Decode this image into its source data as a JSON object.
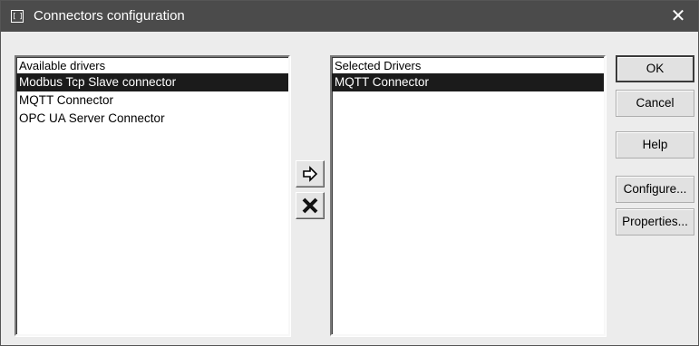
{
  "window": {
    "title": "Connectors configuration",
    "close_glyph": "✕",
    "app_icon_text": "[ ]"
  },
  "available": {
    "header": "Available drivers",
    "items": [
      {
        "label": "Modbus Tcp Slave connector",
        "selected": true
      },
      {
        "label": "MQTT Connector",
        "selected": false
      },
      {
        "label": "OPC UA Server Connector",
        "selected": false
      }
    ]
  },
  "selected": {
    "header": "Selected Drivers",
    "items": [
      {
        "label": "MQTT Connector",
        "selected": true
      }
    ]
  },
  "transfer": {
    "add_icon": "right-arrow-icon",
    "remove_icon": "remove-x-icon"
  },
  "buttons": {
    "ok": "OK",
    "cancel": "Cancel",
    "help": "Help",
    "configure": "Configure...",
    "properties": "Properties..."
  },
  "colors": {
    "titlebar": "#4b4b4b",
    "selection": "#1b1b1b",
    "dialog_bg": "#ececec"
  }
}
